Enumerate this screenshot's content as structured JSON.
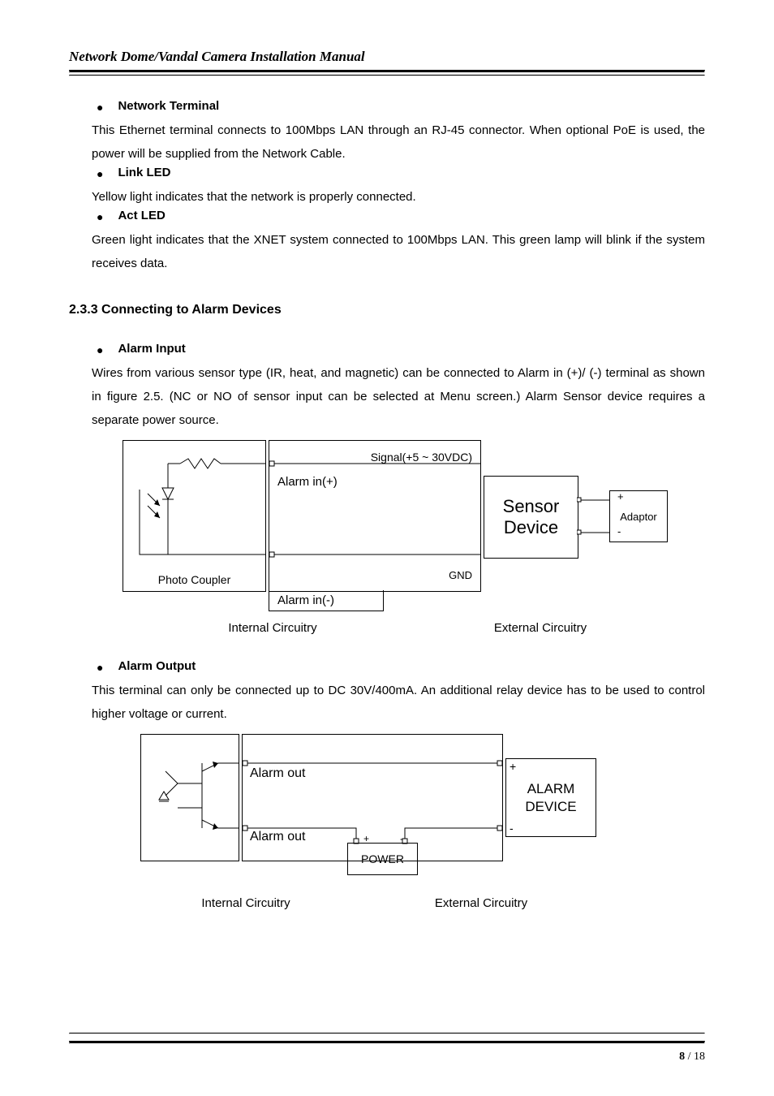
{
  "header": {
    "title": "Network Dome/Vandal Camera Installation Manual"
  },
  "bullets": {
    "network_terminal": {
      "label": "Network Terminal",
      "text": "This Ethernet terminal connects to 100Mbps LAN through an RJ-45 connector. When optional PoE is used, the power will be supplied from the Network Cable."
    },
    "link_led": {
      "label": "Link LED",
      "text": "Yellow light indicates that the network is properly connected."
    },
    "act_led": {
      "label": "Act LED",
      "text": "Green light indicates that the XNET system connected to 100Mbps LAN. This green lamp will blink if the system receives data."
    },
    "alarm_input": {
      "label": "Alarm Input",
      "text": "Wires from various sensor type (IR, heat, and magnetic) can be connected to Alarm in (+)/ (-) terminal as shown in figure 2.5. (NC or NO of sensor input can be selected at Menu screen.) Alarm Sensor device requires a separate power source."
    },
    "alarm_output": {
      "label": "Alarm Output",
      "text": "This terminal can only be connected up to DC 30V/400mA.  An additional relay device has to be used to control higher voltage or current."
    }
  },
  "section_233": "2.3.3 Connecting to Alarm Devices",
  "diagram1": {
    "photo_coupler": "Photo Coupler",
    "signal": "Signal(+5 ~ 30VDC)",
    "alarm_in_plus": "Alarm in(+)",
    "alarm_in_minus": "Alarm in(-)",
    "gnd": "GND",
    "sensor": "Sensor Device",
    "adaptor": "Adaptor",
    "plus": "+",
    "minus": "-",
    "cap_left": "Internal Circuitry",
    "cap_right": "External Circuitry"
  },
  "diagram2": {
    "alarm_out": "Alarm out",
    "power": "POWER",
    "alarm_device": "ALARM DEVICE",
    "plus": "+",
    "minus": "-",
    "cap_left": "Internal Circuitry",
    "cap_right": "External Circuitry"
  },
  "footer": {
    "current": "8",
    "sep": " / ",
    "total": "18"
  }
}
